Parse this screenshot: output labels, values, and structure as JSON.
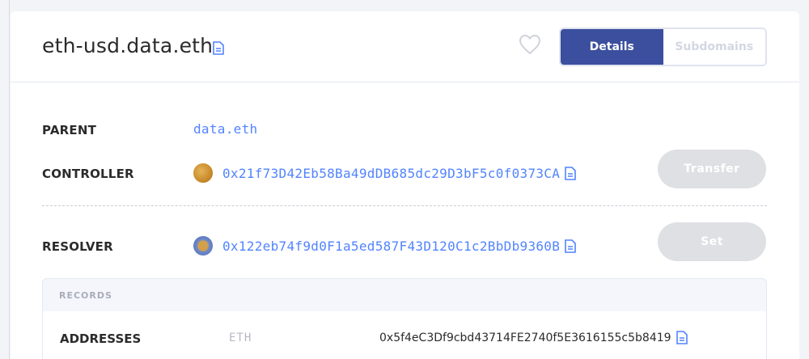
{
  "header": {
    "domain": "eth-usd.data.eth",
    "tabs": [
      {
        "label": "Details",
        "active": true
      },
      {
        "label": "Subdomains",
        "active": false
      }
    ]
  },
  "details": {
    "parent": {
      "label": "PARENT",
      "value": "data.eth"
    },
    "controller": {
      "label": "CONTROLLER",
      "value": "0x21f73D42Eb58Ba49dDB685dc29D3bF5c0f0373CA",
      "button": "Transfer"
    },
    "resolver": {
      "label": "RESOLVER",
      "value": "0x122eb74f9d0F1a5ed587F43D120C1c2BbDb9360B",
      "button": "Set"
    }
  },
  "records": {
    "title": "RECORDS",
    "addresses": {
      "label": "ADDRESSES",
      "coin": "ETH",
      "value": "0x5f4eC3Df9cbd43714FE2740f5E3616155c5b8419"
    }
  },
  "colors": {
    "accent": "#3b4f9e",
    "link": "#5284ff",
    "disabled_button": "#dfe0e4"
  }
}
